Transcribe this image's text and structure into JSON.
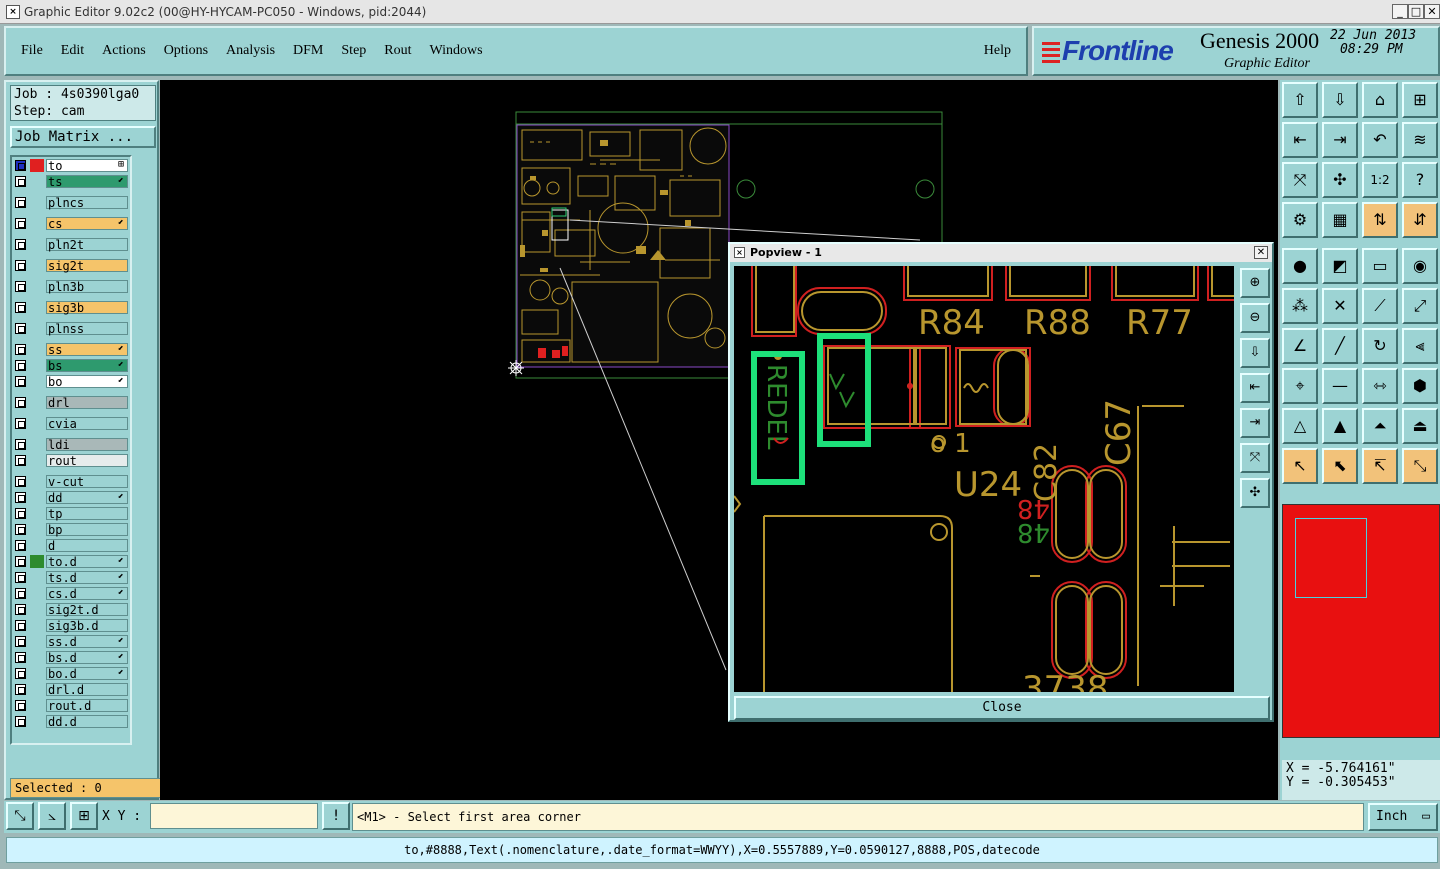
{
  "window": {
    "title": "Graphic Editor 9.02c2 (00@HY-HYCAM-PC050 - Windows, pid:2044)",
    "controls": [
      "_",
      "□",
      "✕"
    ]
  },
  "menu": [
    "File",
    "Edit",
    "Actions",
    "Options",
    "Analysis",
    "DFM",
    "Step",
    "Rout",
    "Windows"
  ],
  "help_label": "Help",
  "brand": {
    "logo": "Frontline",
    "product": "Genesis 2000",
    "subtitle": "Graphic Editor",
    "date": "22 Jun 2013",
    "time": "08:29 PM"
  },
  "job": {
    "job_line": "Job : 4s0390lga0",
    "step_line": "Step: cam",
    "matrix_button": "Job Matrix ..."
  },
  "layers": [
    {
      "name": "to",
      "color": "#ffffff",
      "swatch": "#e02020",
      "mark": "⊞",
      "active": true
    },
    {
      "name": "ts",
      "color": "#2e9a6e",
      "mark": "⬋"
    },
    {
      "name": "plncs",
      "color": "#9cd3d3"
    },
    {
      "name": "cs",
      "color": "#f5c46a",
      "mark": "⬋"
    },
    {
      "name": "pln2t",
      "color": "#9cd3d3"
    },
    {
      "name": "sig2t",
      "color": "#f5c46a"
    },
    {
      "name": "pln3b",
      "color": "#9cd3d3"
    },
    {
      "name": "sig3b",
      "color": "#f5c46a"
    },
    {
      "name": "plnss",
      "color": "#9cd3d3"
    },
    {
      "name": "ss",
      "color": "#f5c46a",
      "mark": "⬋"
    },
    {
      "name": "bs",
      "color": "#2e9a6e",
      "mark": "⬋"
    },
    {
      "name": "bo",
      "color": "#ffffff",
      "mark": "⬋"
    },
    {
      "name": "drl",
      "color": "#a9b8b8"
    },
    {
      "name": "cvia",
      "color": "#9cd3d3"
    },
    {
      "name": "ldi",
      "color": "#a9b8b8"
    },
    {
      "name": "rout",
      "color": "#e6ecec"
    },
    {
      "name": "v-cut",
      "color": "#9cd3d3"
    },
    {
      "name": "dd",
      "color": "#9cd3d3",
      "mark": "⬋"
    },
    {
      "name": "tp",
      "color": "#9cd3d3"
    },
    {
      "name": "bp",
      "color": "#9cd3d3"
    },
    {
      "name": "d",
      "color": "#9cd3d3"
    },
    {
      "name": "to.d",
      "color": "#9cd3d3",
      "swatch": "#2e8b2e",
      "mark": "⬋"
    },
    {
      "name": "ts.d",
      "color": "#9cd3d3",
      "mark": "⬋"
    },
    {
      "name": "cs.d",
      "color": "#9cd3d3",
      "mark": "⬋"
    },
    {
      "name": "sig2t.d",
      "color": "#9cd3d3"
    },
    {
      "name": "sig3b.d",
      "color": "#9cd3d3"
    },
    {
      "name": "ss.d",
      "color": "#9cd3d3",
      "mark": "⬋"
    },
    {
      "name": "bs.d",
      "color": "#9cd3d3",
      "mark": "⬋"
    },
    {
      "name": "bo.d",
      "color": "#9cd3d3",
      "mark": "⬋"
    },
    {
      "name": "drl.d",
      "color": "#9cd3d3"
    },
    {
      "name": "rout.d",
      "color": "#9cd3d3"
    },
    {
      "name": "dd.d",
      "color": "#9cd3d3"
    }
  ],
  "selected_label": "Selected : 0",
  "popview": {
    "title": "Popview - 1",
    "close_label": "Close",
    "labels": {
      "r84": "R84",
      "r88": "R88",
      "r77": "R77",
      "u24": "U24",
      "c82": "C82",
      "c67": "C67",
      "o1": "o 1",
      "n48a": "48",
      "n48b": "48",
      "n3738": "3738",
      "red_text": "REDEL"
    }
  },
  "coords": {
    "x": "X = -5.764161\"",
    "y": "Y = -0.305453\""
  },
  "bottom": {
    "xy_label": "X Y :",
    "xy_value": "",
    "prompt": "<M1> - Select first area corner",
    "unit": "Inch"
  },
  "status_line": "to,#8888,Text(.nomenclature,.date_format=WWYY),X=0.5557889,Y=0.0590127,8888,POS,datecode",
  "tools": [
    {
      "name": "open-step-icon",
      "glyph": "⇧",
      "orange": false
    },
    {
      "name": "save-icon",
      "glyph": "⇩",
      "orange": false
    },
    {
      "name": "home-icon",
      "glyph": "⌂",
      "orange": false
    },
    {
      "name": "window-split-icon",
      "glyph": "⊞",
      "orange": false
    },
    {
      "name": "pan-left-icon",
      "glyph": "⇤",
      "orange": false
    },
    {
      "name": "pan-right-icon",
      "glyph": "⇥",
      "orange": false
    },
    {
      "name": "undo-zoom-icon",
      "glyph": "↶",
      "orange": false
    },
    {
      "name": "redraw-icon",
      "glyph": "≋",
      "orange": false
    },
    {
      "name": "zoom-home-icon",
      "glyph": "⤧",
      "orange": false
    },
    {
      "name": "zoom-fit-icon",
      "glyph": "✣",
      "orange": false
    },
    {
      "name": "scale-icon",
      "glyph": "1:2",
      "orange": false
    },
    {
      "name": "help-icon",
      "glyph": "?",
      "orange": false
    },
    {
      "name": "tools-icon",
      "glyph": "⚙",
      "orange": false
    },
    {
      "name": "grid-icon",
      "glyph": "▦",
      "orange": false
    },
    {
      "name": "layer-features-icon",
      "glyph": "⇅",
      "orange": true
    },
    {
      "name": "layer-attributes-icon",
      "glyph": "⇵",
      "orange": true
    },
    {
      "name": "pad-icon",
      "glyph": "●",
      "orange": false
    },
    {
      "name": "color-icon",
      "glyph": "◩",
      "orange": false
    },
    {
      "name": "ruler-icon",
      "glyph": "▭",
      "orange": false
    },
    {
      "name": "circle-select-icon",
      "glyph": "◉",
      "orange": false
    },
    {
      "name": "connect-icon",
      "glyph": "⁂",
      "orange": false
    },
    {
      "name": "cross-icon",
      "glyph": "✕",
      "orange": false
    },
    {
      "name": "line-add-icon",
      "glyph": "⟋",
      "orange": false
    },
    {
      "name": "line-edit-icon",
      "glyph": "⤢",
      "orange": false
    },
    {
      "name": "angle-icon",
      "glyph": "∠",
      "orange": false
    },
    {
      "name": "slash-icon",
      "glyph": "╱",
      "orange": false
    },
    {
      "name": "rotate-icon",
      "glyph": "↻",
      "orange": false
    },
    {
      "name": "mirror-icon",
      "glyph": "⫷",
      "orange": false
    },
    {
      "name": "measure-icon",
      "glyph": "⌖",
      "orange": false
    },
    {
      "name": "minus-icon",
      "glyph": "—",
      "orange": false
    },
    {
      "name": "distance-icon",
      "glyph": "⇿",
      "orange": false
    },
    {
      "name": "shapes-icon",
      "glyph": "⬢",
      "orange": false
    },
    {
      "name": "triangle-icon",
      "glyph": "△",
      "orange": false
    },
    {
      "name": "triangle-arrow-icon",
      "glyph": "▲",
      "orange": false
    },
    {
      "name": "triangle-up-icon",
      "glyph": "⏶",
      "orange": false
    },
    {
      "name": "triangle-split-icon",
      "glyph": "⏏",
      "orange": false
    },
    {
      "name": "select-arrow-icon",
      "glyph": "↖",
      "orange": true
    },
    {
      "name": "select-box-icon",
      "glyph": "⬉",
      "orange": true
    },
    {
      "name": "select-lasso-icon",
      "glyph": "↸",
      "orange": true
    },
    {
      "name": "select-net-icon",
      "glyph": "⤡",
      "orange": true
    }
  ],
  "popview_tools": [
    {
      "name": "popview-zoom-in-icon",
      "glyph": "⊕"
    },
    {
      "name": "popview-zoom-out-icon",
      "glyph": "⊖"
    },
    {
      "name": "popview-down-icon",
      "glyph": "⇩"
    },
    {
      "name": "popview-left-icon",
      "glyph": "⇤"
    },
    {
      "name": "popview-right-icon",
      "glyph": "⇥"
    },
    {
      "name": "popview-fit-icon",
      "glyph": "⤧"
    },
    {
      "name": "popview-center-icon",
      "glyph": "✣"
    }
  ]
}
